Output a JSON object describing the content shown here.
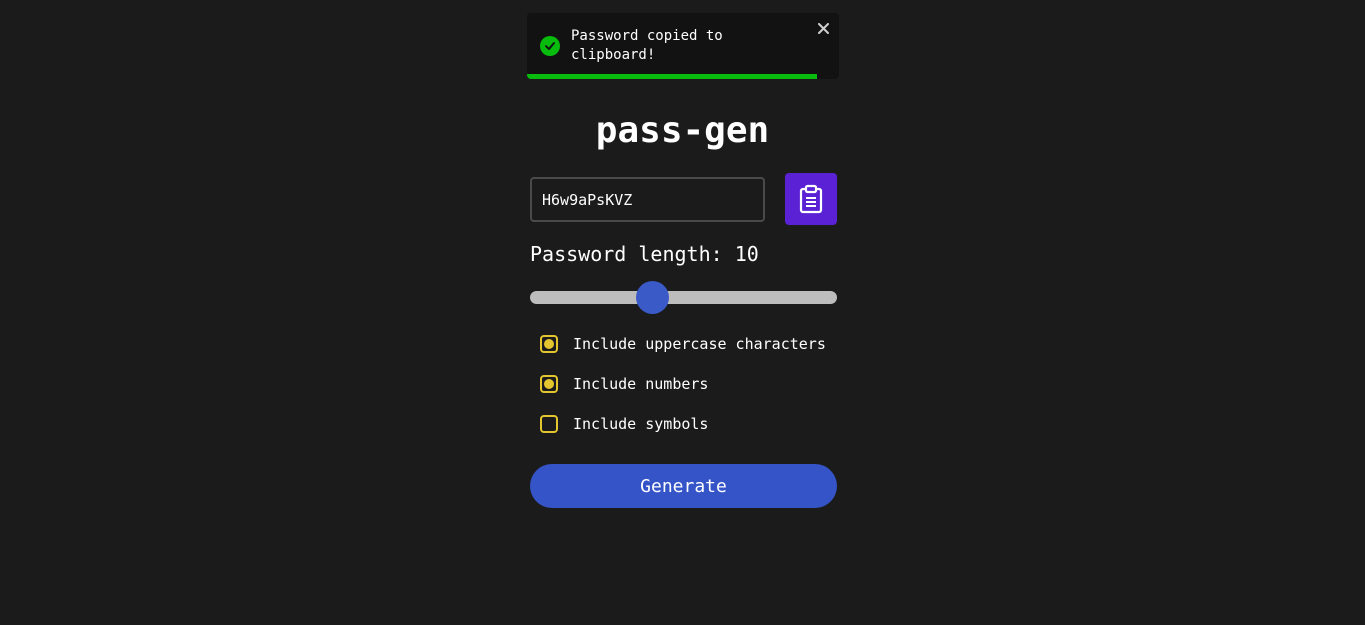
{
  "toast": {
    "message": "Password copied to clipboard!",
    "progress": 0.93,
    "icon": "check-circle-icon",
    "close_icon": "close-icon",
    "color": "#07bc0c"
  },
  "app": {
    "title": "pass-gen"
  },
  "password": {
    "value": "H6w9aPsKVZ",
    "copy_icon": "clipboard-icon",
    "copy_button_color": "#5a22d4"
  },
  "length": {
    "label": "Password length: 10",
    "value": 10
  },
  "options": [
    {
      "label": "Include uppercase characters",
      "checked": true
    },
    {
      "label": "Include numbers",
      "checked": true
    },
    {
      "label": "Include symbols",
      "checked": false
    }
  ],
  "generate": {
    "label": "Generate",
    "color": "#3454c8"
  },
  "colors": {
    "background": "#1b1b1b",
    "accent_yellow": "#e2c52f",
    "slider_thumb": "#3a5ac8"
  }
}
